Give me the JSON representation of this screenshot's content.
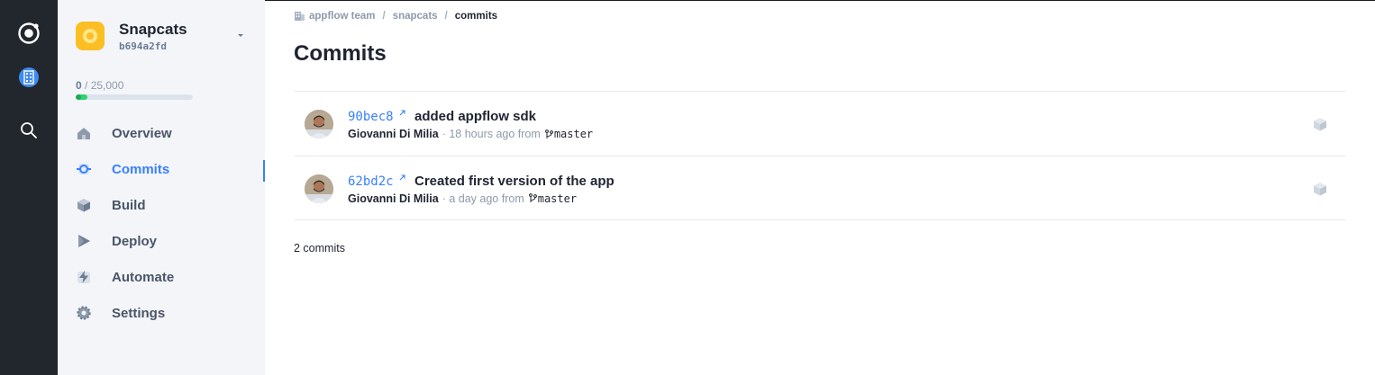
{
  "rail": {
    "logo_icon": "ionic-logo-icon",
    "org_icon": "building-icon",
    "search_icon": "search-icon"
  },
  "app": {
    "name": "Snapcats",
    "id": "b694a2fd",
    "usage_used": "0",
    "usage_total": " / 25,000",
    "usage_fraction": 0.1
  },
  "nav": {
    "items": [
      {
        "label": "Overview",
        "icon": "home-icon"
      },
      {
        "label": "Commits",
        "icon": "commit-icon",
        "active": true
      },
      {
        "label": "Build",
        "icon": "cube-icon"
      },
      {
        "label": "Deploy",
        "icon": "deploy-icon"
      },
      {
        "label": "Automate",
        "icon": "bolt-icon"
      },
      {
        "label": "Settings",
        "icon": "gear-icon"
      }
    ]
  },
  "breadcrumb": {
    "team": "appflow team",
    "app": "snapcats",
    "current": "commits",
    "sep": "/"
  },
  "page": {
    "title": "Commits"
  },
  "commits": [
    {
      "sha": "90bec8",
      "message": "added appflow sdk",
      "author": "Giovanni Di Milia",
      "when": "· 18 hours ago from",
      "branch": "master"
    },
    {
      "sha": "62bd2c",
      "message": "Created first version of the app",
      "author": "Giovanni Di Milia",
      "when": "· a day ago from",
      "branch": "master"
    }
  ],
  "footer": {
    "count": "2 commits"
  },
  "colors": {
    "accent": "#3880ff",
    "rail_bg": "#22262d",
    "sidebar_bg": "#f3f5f9",
    "app_icon": "#fbbf24",
    "usage_fill": "#2dd36f"
  }
}
